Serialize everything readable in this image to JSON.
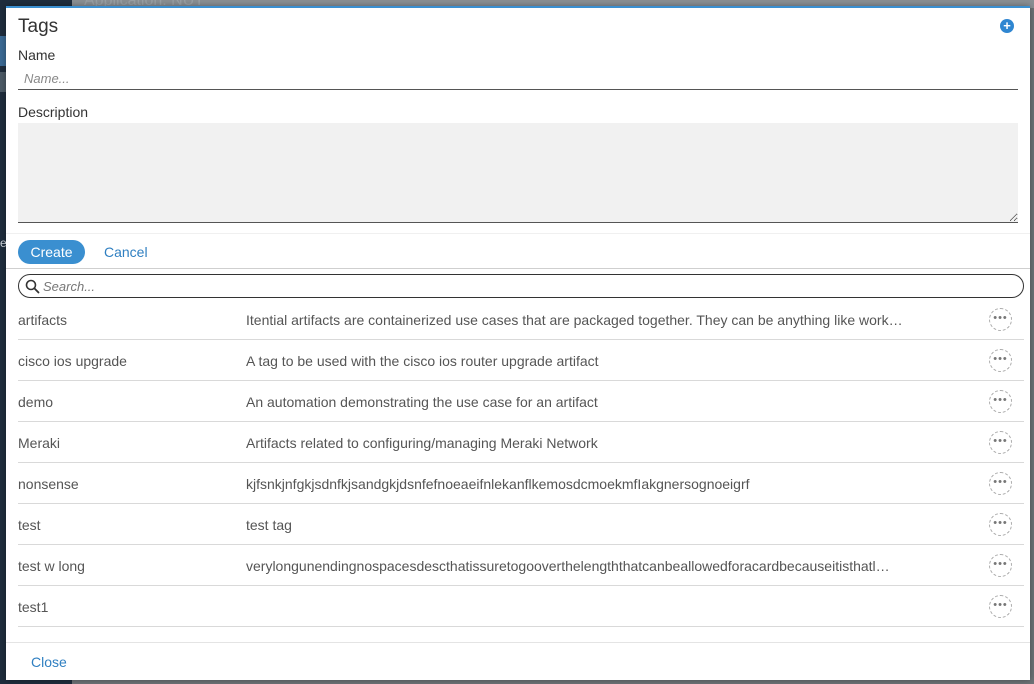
{
  "background": {
    "title_fragment": "Application: NUT",
    "side_letter": "e"
  },
  "modal": {
    "title": "Tags",
    "add_icon": "plus-circle-icon",
    "accent_color": "#3a8fd0",
    "form": {
      "name_label": "Name",
      "name_placeholder": "Name...",
      "name_value": "",
      "description_label": "Description",
      "description_value": ""
    },
    "actions": {
      "create_label": "Create",
      "cancel_label": "Cancel"
    },
    "search": {
      "placeholder": "Search...",
      "icon": "search-icon"
    },
    "tags": [
      {
        "name": "artifacts",
        "description": "Itential artifacts are containerized use cases that are packaged together. They can be anything like work…"
      },
      {
        "name": "cisco ios upgrade",
        "description": "A tag to be used with the cisco ios router upgrade artifact"
      },
      {
        "name": "demo",
        "description": "An automation demonstrating the use case for an artifact"
      },
      {
        "name": "Meraki",
        "description": "Artifacts related to configuring/managing Meraki Network"
      },
      {
        "name": "nonsense",
        "description": "kjfsnkjnfgkjsdnfkjsandgkjdsnfefnoeaeifnlekanflkemosdcmoekmfIakgnersognoeigrf"
      },
      {
        "name": "test",
        "description": "test tag"
      },
      {
        "name": "test w long",
        "description": "verylongunendingnospacesdescthatissuretogooverthelengththatcanbeallowedforacardbecauseitisthatl…"
      },
      {
        "name": "test1",
        "description": ""
      }
    ],
    "more_icon": "more-options-icon",
    "footer": {
      "close_label": "Close"
    }
  }
}
